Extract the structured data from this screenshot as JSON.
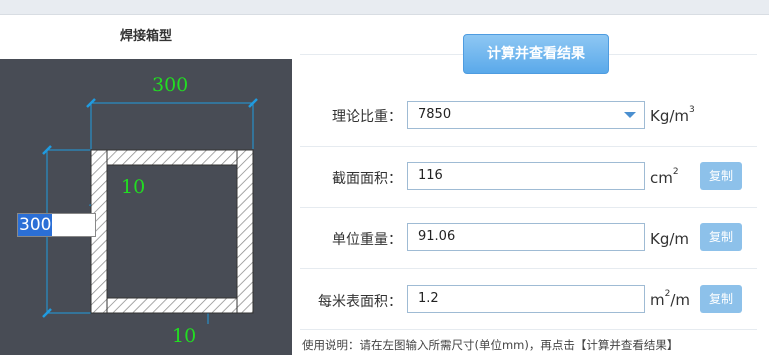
{
  "left": {
    "title": "焊接箱型",
    "dims": {
      "top_width": "300",
      "height_value": "300",
      "web_thickness": "10",
      "flange_thickness": "10"
    }
  },
  "right": {
    "calc_button": "计算并查看结果",
    "rows": [
      {
        "label": "理论比重：",
        "value": "7850",
        "unit": "Kg/m",
        "unit_sup": "3",
        "copy": ""
      },
      {
        "label": "截面面积：",
        "value": "116",
        "unit": "cm",
        "unit_sup": "2",
        "copy": "复制"
      },
      {
        "label": "单位重量：",
        "value": "91.06",
        "unit": "Kg/m",
        "unit_sup": "",
        "copy": "复制"
      },
      {
        "label": "每米表面积：",
        "value": "1.2",
        "unit": "m",
        "unit_sup": "2",
        "unit_suffix": "/m",
        "copy": "复制"
      }
    ],
    "usage": "使用说明：请在左图输入所需尺寸(单位mm)，再点击【计算并查看结果】"
  },
  "colors": {
    "canvas_bg": "#484c55",
    "dim_text": "#22dd22",
    "dim_line": "#1f9be0",
    "button": "#5aa9ea",
    "copy_button": "#8dc1ea"
  }
}
